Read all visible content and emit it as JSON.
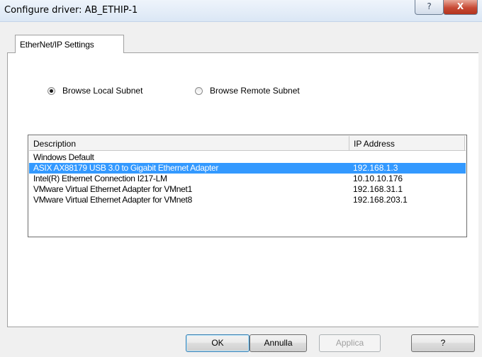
{
  "window": {
    "title": "Configure driver: AB_ETHIP-1",
    "help_glyph": "?",
    "close_glyph": "X"
  },
  "tabs": [
    {
      "label": "EtherNet/IP Settings",
      "active": true
    }
  ],
  "browse": {
    "local_label": "Browse Local Subnet",
    "remote_label": "Browse Remote Subnet",
    "selected": "local"
  },
  "list": {
    "columns": [
      "Description",
      "IP Address"
    ],
    "rows": [
      {
        "description": "Windows Default",
        "ip": ""
      },
      {
        "description": "ASIX AX88179 USB 3.0 to Gigabit Ethernet Adapter",
        "ip": "192.168.1.3",
        "selected": true
      },
      {
        "description": "Intel(R) Ethernet Connection I217-LM",
        "ip": "10.10.10.176"
      },
      {
        "description": "VMware Virtual Ethernet Adapter for VMnet1",
        "ip": "192.168.31.1"
      },
      {
        "description": "VMware Virtual Ethernet Adapter for VMnet8",
        "ip": "192.168.203.1"
      }
    ],
    "selection_color": "#3399ff"
  },
  "buttons": {
    "ok": "OK",
    "cancel": "Annulla",
    "apply": "Applica",
    "help": "?"
  }
}
